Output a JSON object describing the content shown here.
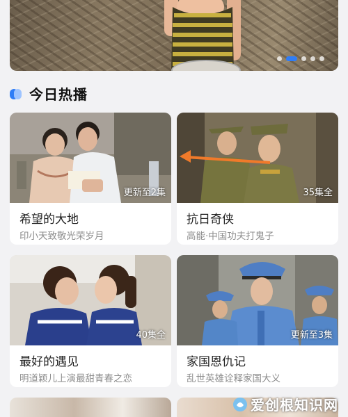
{
  "section": {
    "title": "今日热播"
  },
  "banner": {
    "page_count": 5,
    "active_index": 1
  },
  "shows": [
    {
      "title": "希望的大地",
      "subtitle": "印小天致敬光荣岁月",
      "badge": "更新至2集"
    },
    {
      "title": "抗日奇侠",
      "subtitle": "高能·中国功夫打鬼子",
      "badge": "35集全"
    },
    {
      "title": "最好的遇见",
      "subtitle": "明道颖儿上演最甜青春之恋",
      "badge": "40集全"
    },
    {
      "title": "家国恩仇记",
      "subtitle": "乱世英雄诠释家国大义",
      "badge": "更新至3集"
    }
  ],
  "watermark": {
    "text": "爱创根知识网"
  },
  "colors": {
    "accent": "#2f7df6",
    "arrow": "#f07a2a"
  }
}
